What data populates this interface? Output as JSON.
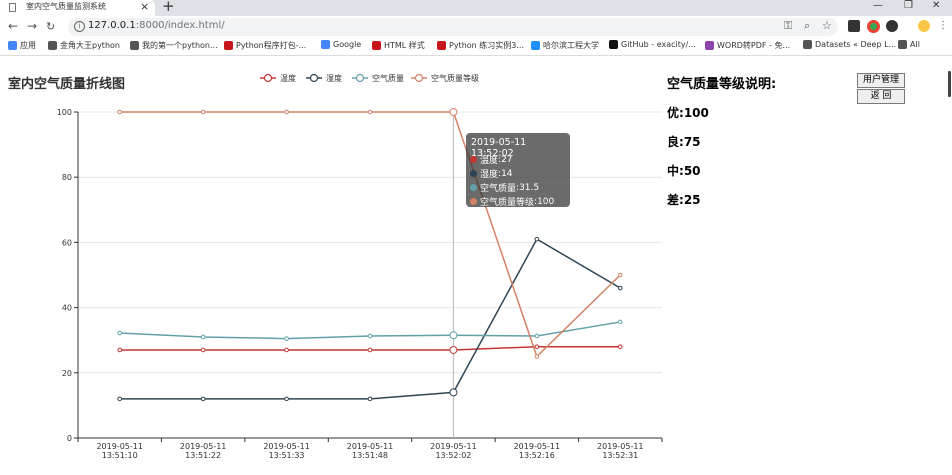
{
  "browser": {
    "tab_title": "室内空气质量监测系统",
    "url_host": "127.0.0.1",
    "url_rest": ":8000/index.html/",
    "bookmarks": [
      {
        "label": "应用",
        "icon": "apps-grid-icon",
        "color": "#4285f4"
      },
      {
        "label": "金角大王python",
        "icon": "page-icon",
        "color": "#555555"
      },
      {
        "label": "我的第一个python...",
        "icon": "page-icon",
        "color": "#555555"
      },
      {
        "label": "Python程序打包-...",
        "icon": "csdn-icon",
        "color": "#c8161d"
      },
      {
        "label": "Google",
        "icon": "google-icon",
        "color": "#4285f4"
      },
      {
        "label": "HTML 样式",
        "icon": "site-icon",
        "color": "#c8161d"
      },
      {
        "label": "Python 练习实例3...",
        "icon": "site-icon",
        "color": "#c8161d"
      },
      {
        "label": "哈尔滨工程大学",
        "icon": "site-icon",
        "color": "#1e90ff"
      },
      {
        "label": "GitHub - exacity/...",
        "icon": "github-icon",
        "color": "#111111"
      },
      {
        "label": "WORD转PDF - 免...",
        "icon": "site-icon",
        "color": "#8e44ad"
      },
      {
        "label": "Datasets « Deep L...",
        "icon": "page-icon",
        "color": "#555555"
      },
      {
        "label": "All",
        "icon": "page-icon",
        "color": "#555555"
      }
    ]
  },
  "page": {
    "title": "室内空气质量折线图",
    "aqi_title": "空气质量等级说明:",
    "levels": [
      {
        "label": "优:",
        "value": "100"
      },
      {
        "label": "良:",
        "value": "75"
      },
      {
        "label": "中:",
        "value": "50"
      },
      {
        "label": "差:",
        "value": "25"
      }
    ],
    "buttons": {
      "user_admin": "用户管理",
      "back": "返  回"
    }
  },
  "chart_data": {
    "type": "line",
    "x": [
      "2019-05-11\n13:51:10",
      "2019-05-11\n13:51:22",
      "2019-05-11\n13:51:33",
      "2019-05-11\n13:51:48",
      "2019-05-11\n13:52:02",
      "2019-05-11\n13:52:16",
      "2019-05-11\n13:52:31"
    ],
    "ylim": [
      0,
      100
    ],
    "yticks": [
      0,
      20,
      40,
      60,
      80,
      100
    ],
    "grid": true,
    "legend_position": "top-center",
    "series": [
      {
        "name": "温度",
        "color": "#c23531",
        "values": [
          27,
          27,
          27,
          27,
          27,
          28,
          28
        ]
      },
      {
        "name": "湿度",
        "color": "#2f4554",
        "values": [
          12,
          12,
          12,
          12,
          14,
          61,
          46
        ]
      },
      {
        "name": "空气质量",
        "color": "#61a0a8",
        "values": [
          32.2,
          31,
          30.5,
          31.3,
          31.5,
          31.3,
          35.6
        ]
      },
      {
        "name": "空气质量等级",
        "color": "#d48265",
        "values": [
          100,
          100,
          100,
          100,
          100,
          25,
          50
        ]
      }
    ],
    "tooltip": {
      "title": "2019-05-11 13:52:02",
      "index": 4,
      "rows": [
        {
          "label": "温度",
          "value": "27",
          "color": "#c23531"
        },
        {
          "label": "湿度",
          "value": "14",
          "color": "#2f4554"
        },
        {
          "label": "空气质量",
          "value": "31.5",
          "color": "#61a0a8"
        },
        {
          "label": "空气质量等级",
          "value": "100",
          "color": "#d48265"
        }
      ]
    }
  }
}
